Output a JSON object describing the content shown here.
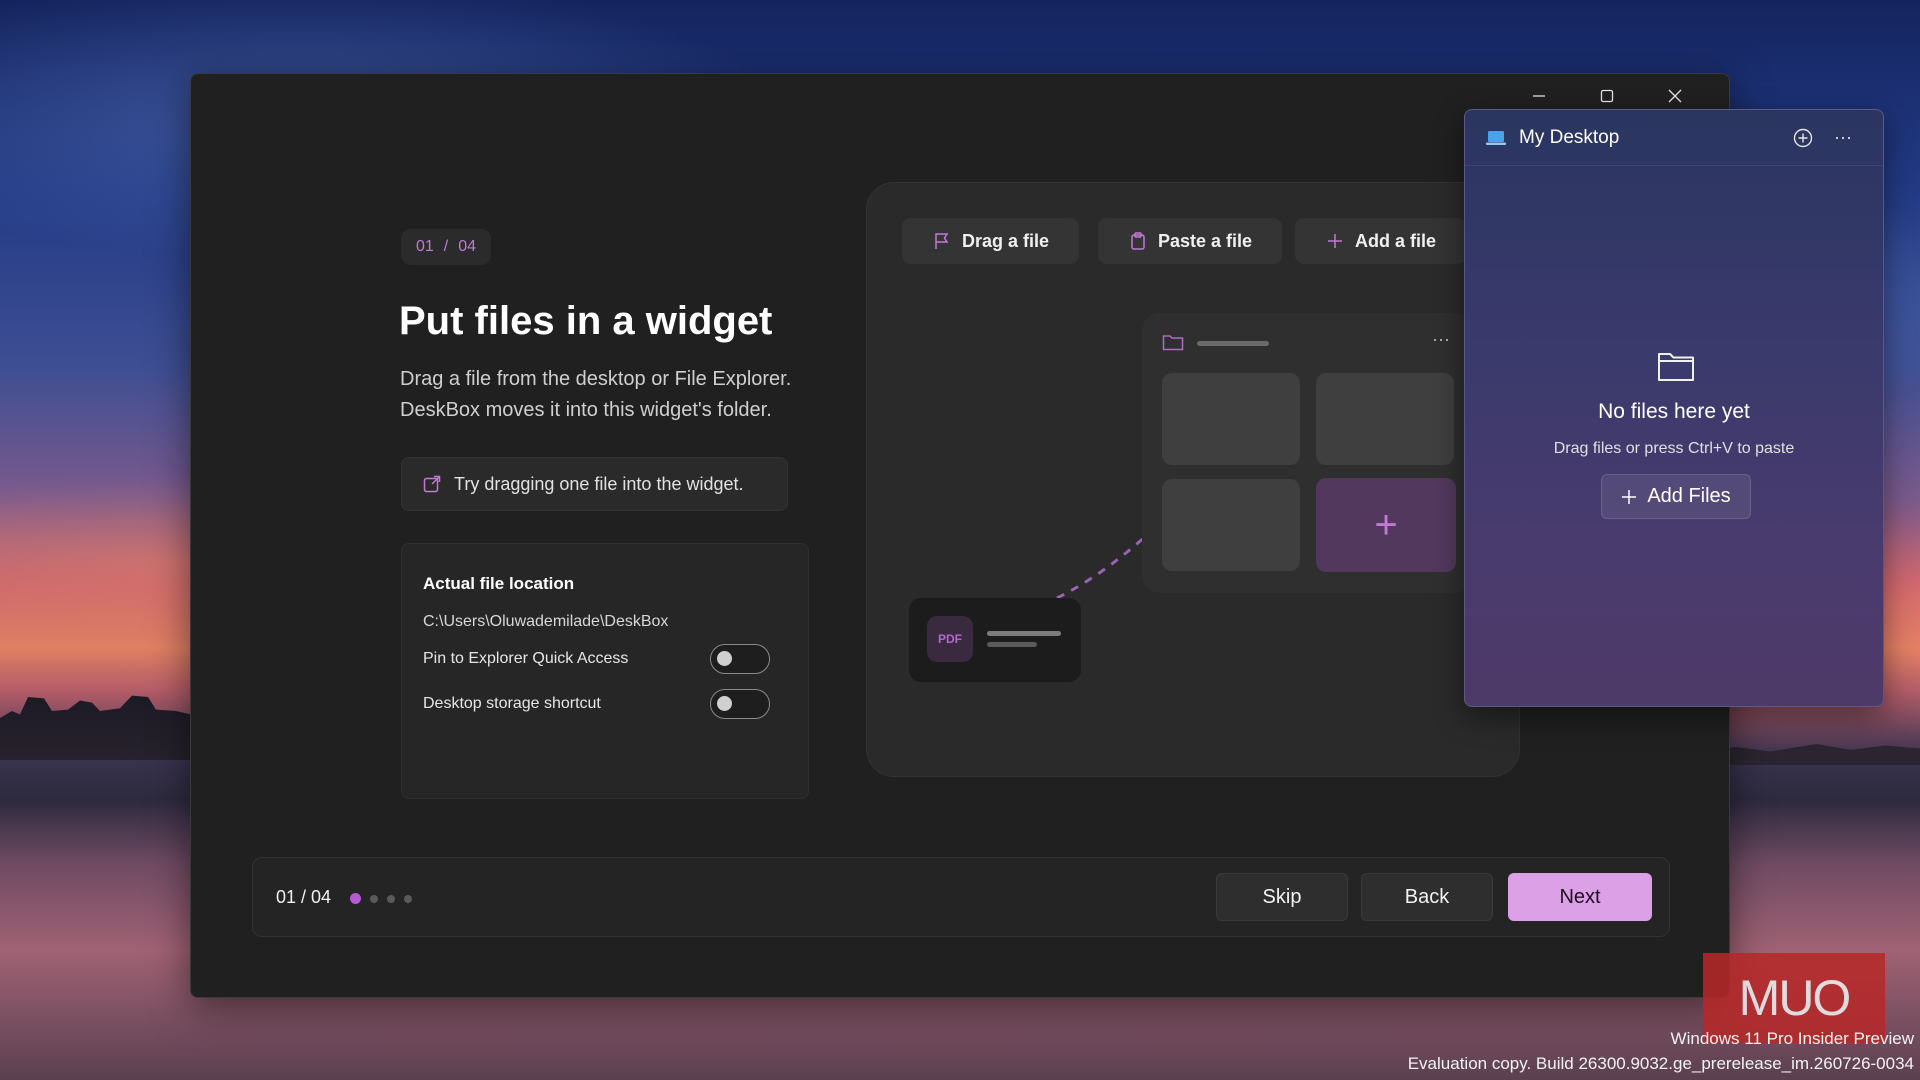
{
  "window": {
    "controls": [
      "minimize",
      "maximize",
      "close"
    ]
  },
  "onboarding": {
    "step_current": "01",
    "step_separator": "/",
    "step_total": "04",
    "title": "Put files in a widget",
    "description_line1": "Drag a file from the desktop or File Explorer.",
    "description_line2": "DeskBox moves it into this widget's folder.",
    "hint": "Try dragging one file into the widget.",
    "location_card": {
      "title": "Actual file location",
      "path": "C:\\Users\\Oluwademilade\\DeskBox",
      "pin_label": "Pin to Explorer Quick Access",
      "pin_enabled": false,
      "shortcut_label": "Desktop storage shortcut",
      "shortcut_enabled": false
    }
  },
  "illustration": {
    "buttons": [
      "Drag a file",
      "Paste a file",
      "Add a file"
    ],
    "file_badge": "PDF"
  },
  "footer": {
    "progress_text": "01 / 04",
    "steps": 4,
    "active_step": 1,
    "skip": "Skip",
    "back": "Back",
    "next": "Next"
  },
  "widget": {
    "title": "My Desktop",
    "empty_title": "No files here yet",
    "empty_sub": "Drag files or press Ctrl+V to paste",
    "add_button": "Add Files"
  },
  "watermark": "MUO",
  "desktop": {
    "eval_line1": "Windows 11 Pro Insider Preview",
    "eval_line2": "Evaluation copy. Build 26300.9032.ge_prerelease_im.260726-0034"
  },
  "colors": {
    "accent": "#b45ad2",
    "next_button": "#dba0e6",
    "window_bg": "#202020"
  }
}
